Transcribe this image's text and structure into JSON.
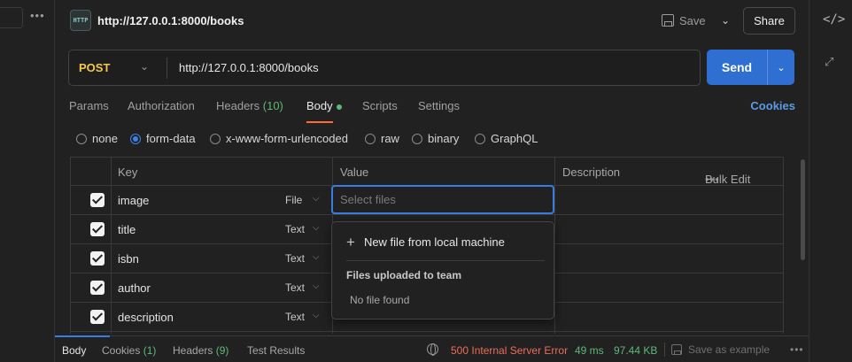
{
  "left": {
    "dots": "•••"
  },
  "header": {
    "badge": "HTTP",
    "title": "http://127.0.0.1:8000/books",
    "save_label": "Save",
    "share_label": "Share"
  },
  "url_bar": {
    "method": "POST",
    "url": "http://127.0.0.1:8000/books",
    "send_label": "Send"
  },
  "tabs": {
    "params": "Params",
    "authorization": "Authorization",
    "headers": "Headers",
    "headers_count": "(10)",
    "body": "Body",
    "scripts": "Scripts",
    "settings": "Settings",
    "cookies": "Cookies",
    "active": "Body"
  },
  "body_types": {
    "options": [
      "none",
      "form-data",
      "x-www-form-urlencoded",
      "raw",
      "binary",
      "GraphQL"
    ],
    "selected": "form-data"
  },
  "table": {
    "headers": {
      "key": "Key",
      "value": "Value",
      "description": "Description",
      "bulk_edit": "Bulk Edit"
    },
    "rows": [
      {
        "checked": true,
        "key": "image",
        "type": "File"
      },
      {
        "checked": true,
        "key": "title",
        "type": "Text"
      },
      {
        "checked": true,
        "key": "isbn",
        "type": "Text"
      },
      {
        "checked": true,
        "key": "author",
        "type": "Text"
      },
      {
        "checked": true,
        "key": "description",
        "type": "Text"
      }
    ],
    "value_placeholder": "Select files"
  },
  "file_dropdown": {
    "new_file": "New file from local machine",
    "section_title": "Files uploaded to team",
    "empty": "No file found"
  },
  "response": {
    "tabs": {
      "body": "Body",
      "cookies": "Cookies",
      "cookies_count": "(1)",
      "headers": "Headers",
      "headers_count": "(9)",
      "test_results": "Test Results"
    },
    "status": "500 Internal Server Error",
    "time": "49 ms",
    "size": "97.44 KB",
    "save_example": "Save as example",
    "dots": "•••"
  },
  "colors": {
    "accent_blue": "#2f6fd1",
    "method_post": "#f2c94c",
    "status_error": "#ea6d5a",
    "success_green": "#5fb77a",
    "tab_underline": "#ff6c37"
  }
}
